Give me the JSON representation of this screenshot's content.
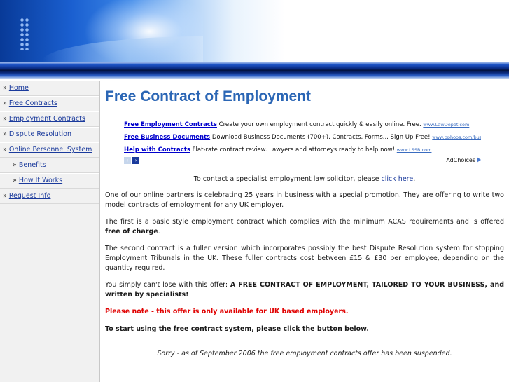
{
  "nav": [
    {
      "label": "Home",
      "sub": false
    },
    {
      "label": "Free Contracts",
      "sub": false
    },
    {
      "label": "Employment Contracts",
      "sub": false
    },
    {
      "label": "Dispute Resolution",
      "sub": false
    },
    {
      "label": "Online Personnel System",
      "sub": false
    },
    {
      "label": "Benefits",
      "sub": true
    },
    {
      "label": "How It Works",
      "sub": true
    },
    {
      "label": "Request Info",
      "sub": false
    }
  ],
  "nav_bullet": "»",
  "page_title": "Free Contract of Employment",
  "ads": [
    {
      "title": "Free Employment Contracts",
      "desc": "Create your own employment contract quickly & easily online. Free.",
      "url": "www.LawDepot.com"
    },
    {
      "title": "Free Business Documents",
      "desc": "Download Business Documents (700+), Contracts, Forms... Sign Up Free!",
      "url": "www.bphoos.com/busines"
    },
    {
      "title": "Help with Contracts",
      "desc": "Flat-rate contract review. Lawyers and attorneys ready to help now!",
      "url": "www.LSSB.com"
    }
  ],
  "ad_prev": "‹",
  "ad_next": "›",
  "adchoices": "AdChoices",
  "contact": {
    "prefix": "To contact a specialist employment law solicitor, please ",
    "link": "click here",
    "suffix": "."
  },
  "para1": "One of our online partners is celebrating 25 years in business with a special promotion. They are offering to write two model contracts of employment for any UK employer.",
  "para2": {
    "text": "The first is a basic style employment contract which complies with the minimum ACAS requirements and is offered ",
    "bold": "free of charge",
    "end": "."
  },
  "para3": "The second contract is a fuller version which incorporates possibly the best Dispute Resolution system for stopping Employment Tribunals in the UK. These fuller contracts cost between £15 & £30 per employee, depending on the quantity required.",
  "para4": {
    "text": "You simply can't lose with this offer: ",
    "bold": "A FREE CONTRACT OF EMPLOYMENT, TAILORED TO YOUR BUSINESS, and written by specialists!"
  },
  "note": "Please note - this offer is only available for UK based employers.",
  "start": "To start using the free contract system, please click the button below.",
  "sorry": "Sorry - as of September 2006 the free employment contracts offer has been suspended."
}
